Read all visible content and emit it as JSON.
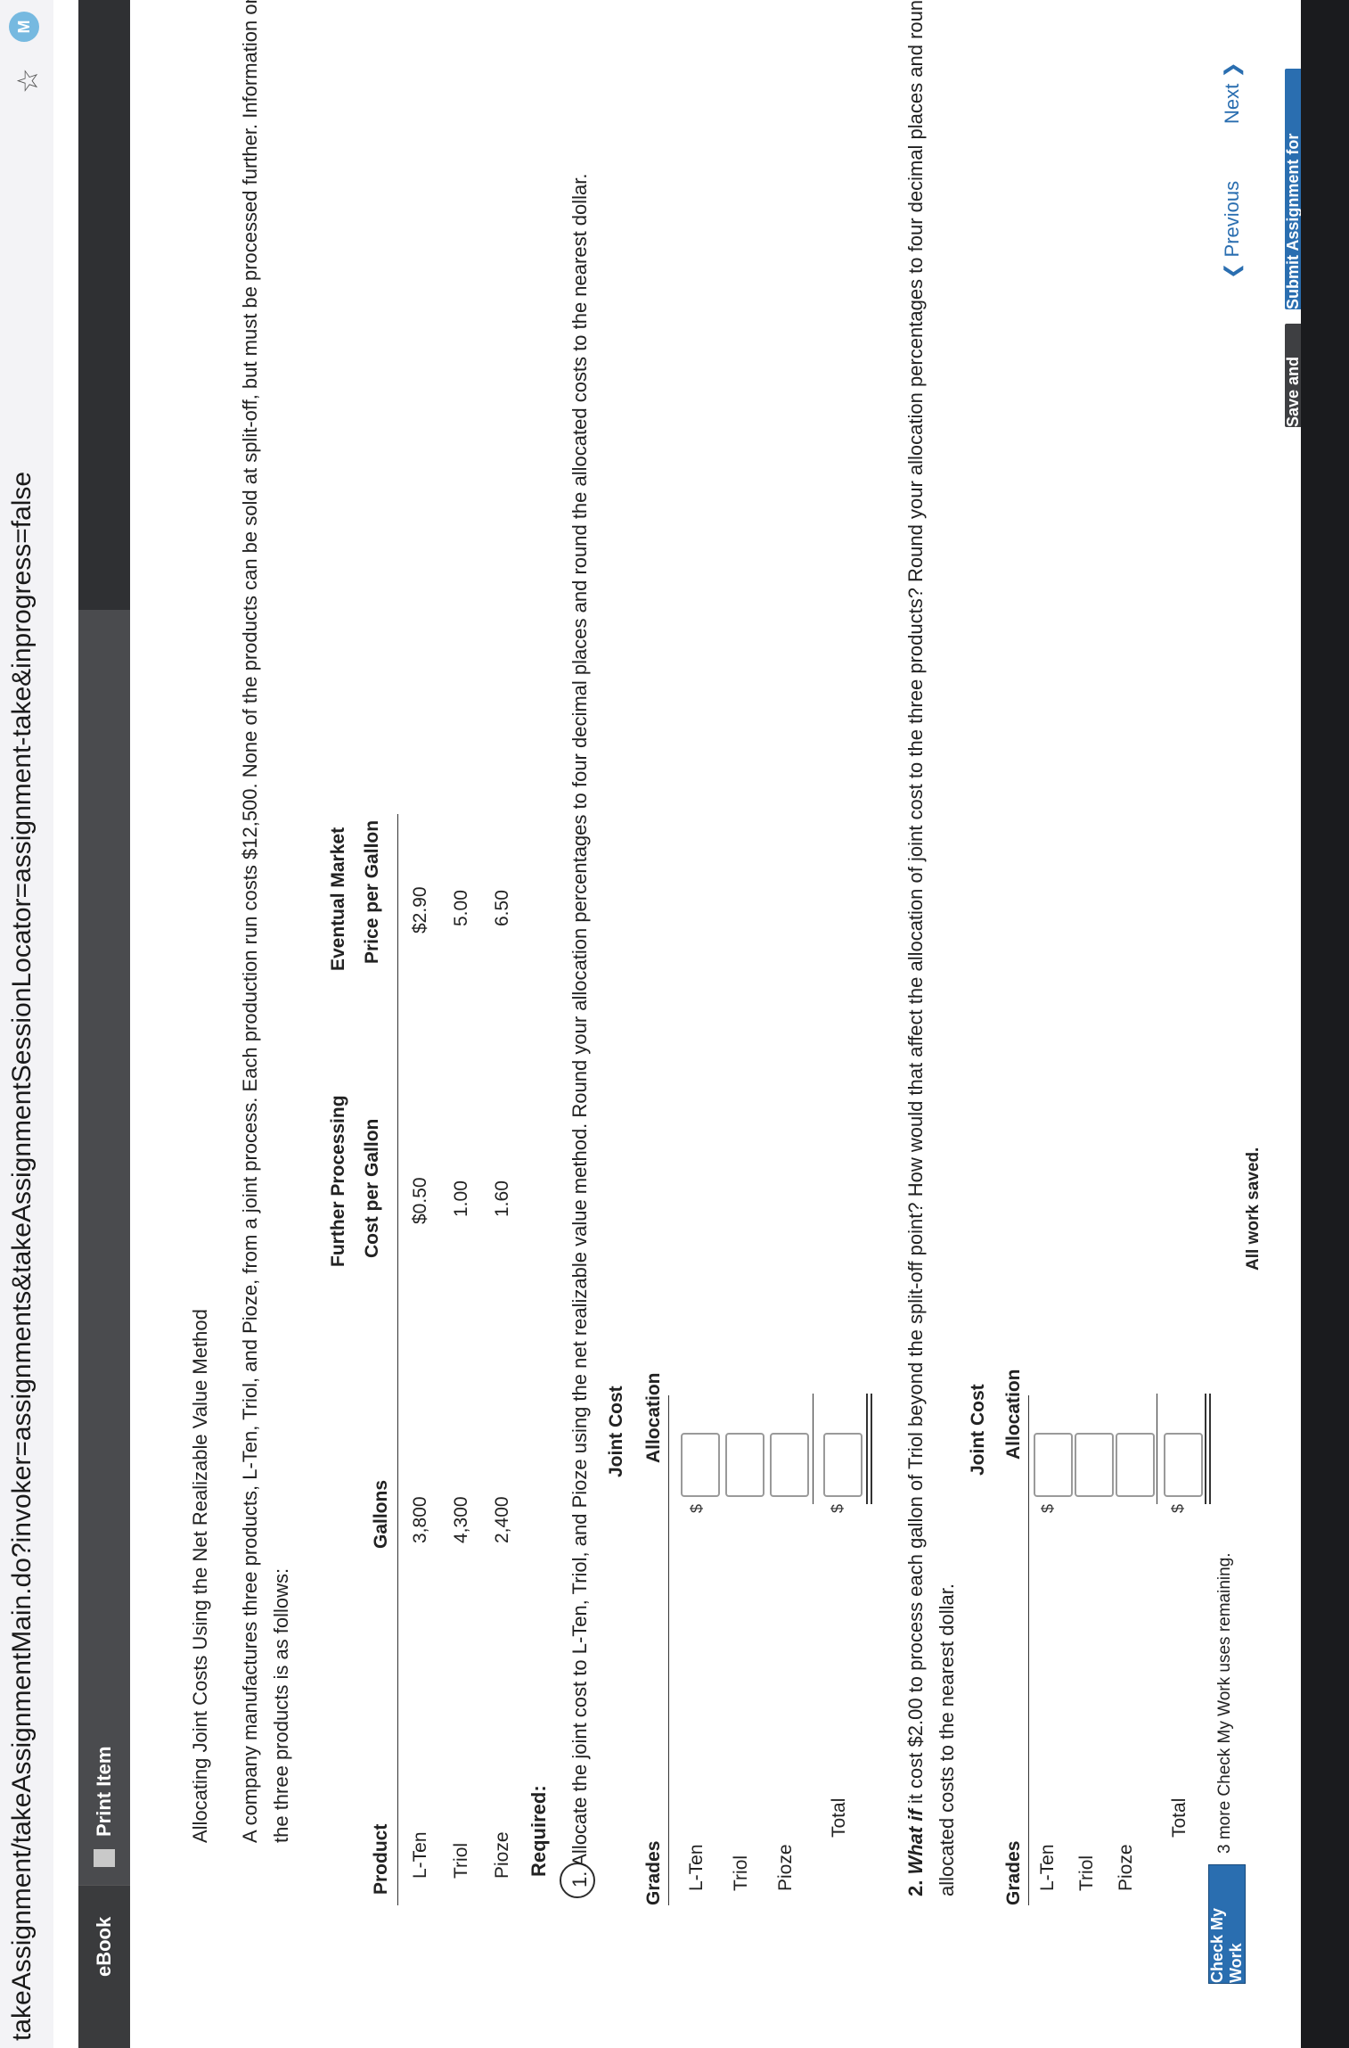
{
  "browser": {
    "url": "takeAssignment/takeAssignmentMain.do?invoker=assignments&takeAssignmentSessionLocator=assignment-take&inprogress=false",
    "profile_initial": "M"
  },
  "tabs": {
    "ebook": "eBook",
    "print_item": "Print Item"
  },
  "problem": {
    "title": "Allocating Joint Costs Using the Net Realizable Value Method",
    "intro_line1": "A company manufactures three products, L-Ten, Triol, and Pioze, from a joint process. Each production run costs $12,500. None of the products can be sold at split-off, but must be processed further. Information on one batch of",
    "intro_line2": "the three products is as follows:"
  },
  "products_table": {
    "headers": {
      "product": "Product",
      "gallons": "Gallons",
      "fpc_1": "Further Processing",
      "fpc_2": "Cost per Gallon",
      "emp_1": "Eventual Market",
      "emp_2": "Price per Gallon"
    },
    "rows": [
      {
        "product": "L-Ten",
        "gallons": "3,800",
        "cost": "$0.50",
        "price": "$2.90"
      },
      {
        "product": "Triol",
        "gallons": "4,300",
        "cost": "1.00",
        "price": "5.00"
      },
      {
        "product": "Pioze",
        "gallons": "2,400",
        "cost": "1.60",
        "price": "6.50"
      }
    ]
  },
  "required_label": "Required:",
  "req1": {
    "text": "1. Allocate the joint cost to L-Ten, Triol, and Pioze using the net realizable value method. Round your allocation percentages to four decimal places and round the allocated costs to the nearest dollar.",
    "col_grades": "Grades",
    "col_joint": "Joint Cost",
    "col_alloc": "Allocation",
    "rows": [
      "L-Ten",
      "Triol",
      "Pioze",
      "Total"
    ],
    "currency": "$"
  },
  "req2": {
    "what_if": "What if",
    "num": "2.",
    "text_line1_rest": " it cost $2.00 to process each gallon of Triol beyond the split-off point? How would that affect the allocation of joint cost to the three products? Round your allocation percentages to four decimal places and round the",
    "text_line2": "allocated costs to the nearest dollar.",
    "col_grades": "Grades",
    "col_joint": "Joint Cost",
    "col_alloc": "Allocation",
    "rows": [
      "L-Ten",
      "Triol",
      "Pioze",
      "Total"
    ],
    "currency": "$"
  },
  "check": {
    "button": "Check My Work",
    "note": "3 more Check My Work uses remaining."
  },
  "status": "All work saved.",
  "nav": {
    "previous": "Previous",
    "next": "Next"
  },
  "actions": {
    "save_exit": "Save and Exit",
    "submit": "Submit Assignment for Grading"
  }
}
